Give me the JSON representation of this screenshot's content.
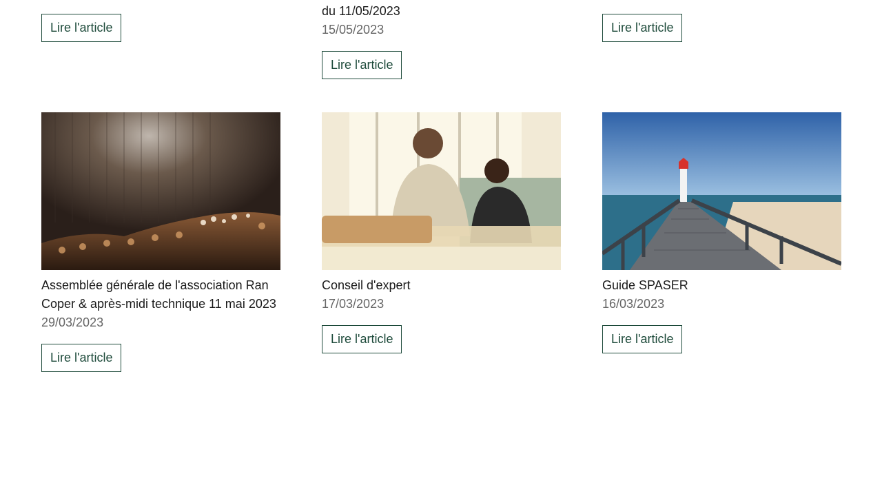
{
  "top_row": [
    {
      "title_tail": "",
      "date": "",
      "button_label": "Lire l'article"
    },
    {
      "title_tail": "du 11/05/2023",
      "date": "15/05/2023",
      "button_label": "Lire l'article"
    },
    {
      "title_tail": "",
      "date": "",
      "button_label": "Lire l'article"
    }
  ],
  "articles": [
    {
      "title_line1": "Assemblée générale de l'association Ran",
      "title_line2": "Coper & après-midi technique 11 mai 2023",
      "date": "29/03/2023",
      "button_label": "Lire l'article",
      "image": "concert-crowd-photo"
    },
    {
      "title_line1": "Conseil d'expert",
      "title_line2": "",
      "date": "17/03/2023",
      "button_label": "Lire l'article",
      "image": "meeting-photo"
    },
    {
      "title_line1": "Guide SPASER",
      "title_line2": "",
      "date": "16/03/2023",
      "button_label": "Lire l'article",
      "image": "lighthouse-pier-photo"
    }
  ],
  "colors": {
    "button_border": "#1d4a3a",
    "date_text": "#666666"
  }
}
